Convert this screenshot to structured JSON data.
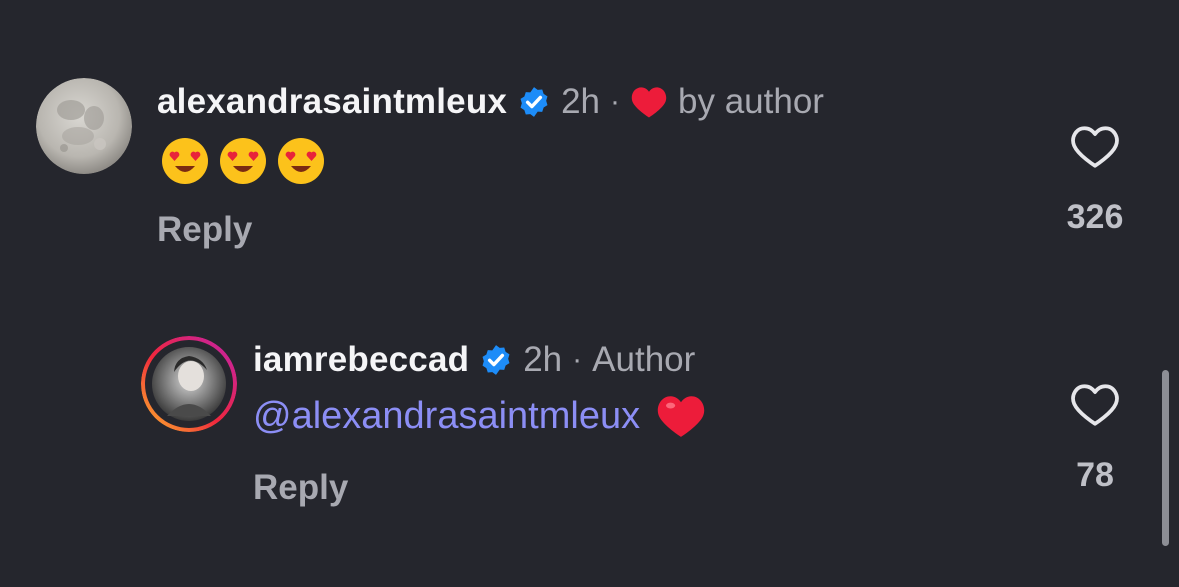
{
  "comments": [
    {
      "username": "alexandrasaintmleux",
      "time": "2h",
      "separator": "·",
      "badge_text": "by author",
      "emojis": [
        "heart-eyes-emoji",
        "heart-eyes-emoji",
        "heart-eyes-emoji"
      ],
      "reply_label": "Reply",
      "like_count": "326"
    },
    {
      "username": "iamrebeccad",
      "time": "2h",
      "separator": "·",
      "badge_text": "Author",
      "mention": "@alexandrasaintmleux",
      "reply_label": "Reply",
      "like_count": "78"
    }
  ],
  "colors": {
    "background": "#25262d",
    "mention": "#8c8ef5",
    "verified": "#1d8cf8",
    "liked_heart": "#ed1c3a"
  },
  "icons": {
    "verified": "verified-badge-icon",
    "author_like": "heart-filled-icon",
    "like": "heart-outline-icon"
  }
}
